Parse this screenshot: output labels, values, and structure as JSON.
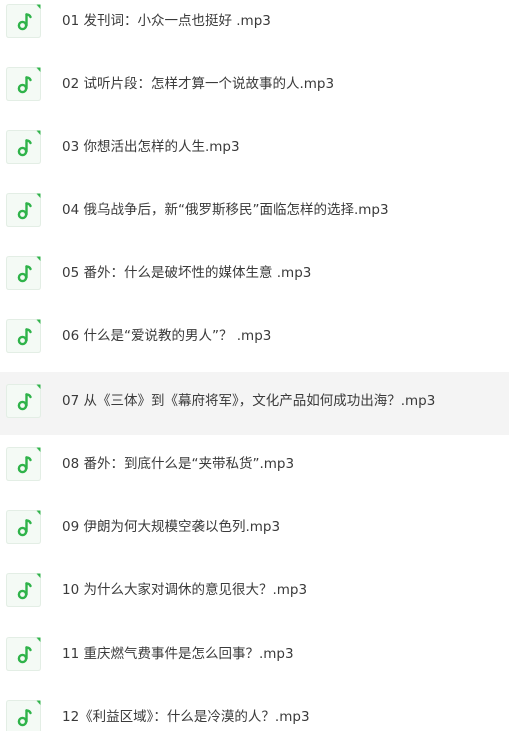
{
  "files": [
    {
      "name": "01 发刊词：小众一点也挺好 .mp3",
      "icon": "audio-file-icon"
    },
    {
      "name": "02 试听片段：怎样才算一个说故事的人.mp3",
      "icon": "audio-file-icon"
    },
    {
      "name": "03 你想活出怎样的人生.mp3",
      "icon": "audio-file-icon"
    },
    {
      "name": "04 俄乌战争后，新“俄罗斯移民”面临怎样的选择.mp3",
      "icon": "audio-file-icon"
    },
    {
      "name": "05 番外：什么是破坏性的媒体生意 .mp3",
      "icon": "audio-file-icon"
    },
    {
      "name": "06 什么是“爱说教的男人”？ .mp3",
      "icon": "audio-file-icon"
    },
    {
      "name": "07 从《三体》到《幕府将军》，文化产品如何成功出海？.mp3",
      "icon": "audio-file-icon",
      "highlighted": true
    },
    {
      "name": "08 番外：到底什么是“夹带私货”.mp3",
      "icon": "audio-file-icon"
    },
    {
      "name": "09 伊朗为何大规模空袭以色列.mp3",
      "icon": "audio-file-icon"
    },
    {
      "name": "10 为什么大家对调休的意见很大？.mp3",
      "icon": "audio-file-icon"
    },
    {
      "name": "11 重庆燃气费事件是怎么回事？.mp3",
      "icon": "audio-file-icon"
    },
    {
      "name": "12《利益区域》：什么是冷漠的人？.mp3",
      "icon": "audio-file-icon"
    }
  ],
  "colors": {
    "icon_accent": "#2fb34a",
    "icon_bg": "#f4faf5",
    "icon_border": "#e3eee5",
    "highlight_bg": "#f4f4f4",
    "text": "#3a3a3a"
  }
}
